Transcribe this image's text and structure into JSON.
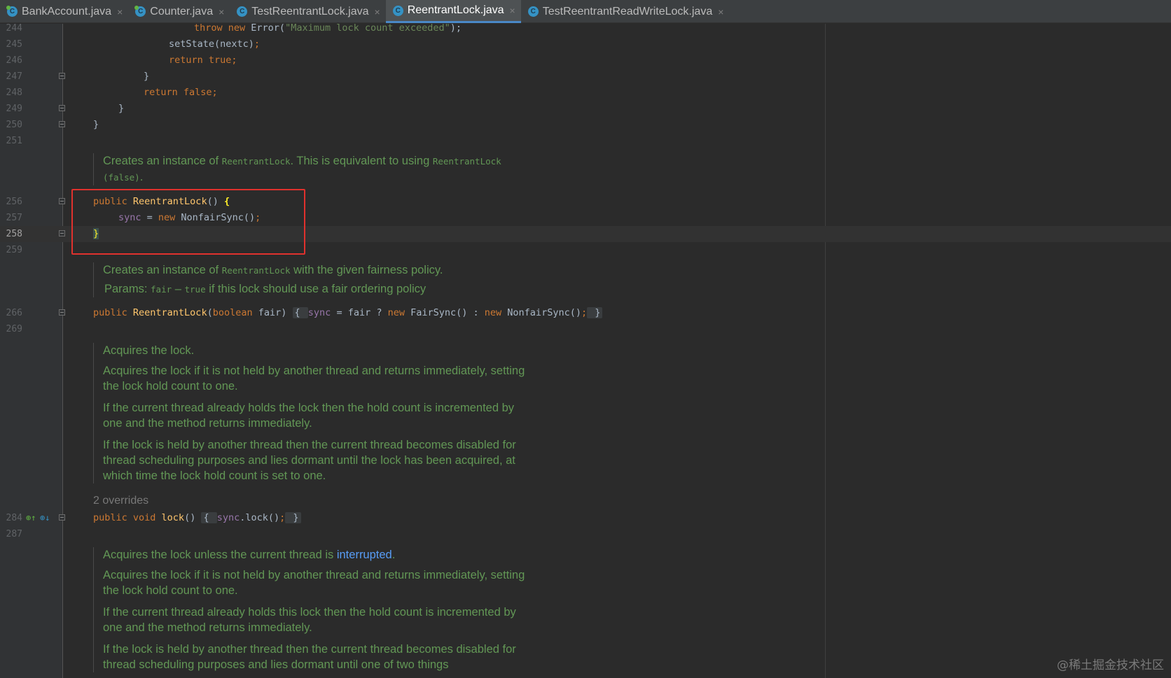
{
  "tabs": [
    {
      "label": "BankAccount.java",
      "close": "×",
      "active": false
    },
    {
      "label": "Counter.java",
      "close": "×",
      "active": false
    },
    {
      "label": "TestReentrantLock.java",
      "close": "×",
      "active": false
    },
    {
      "label": "ReentrantLock.java",
      "close": "×",
      "active": true
    },
    {
      "label": "TestReentrantReadWriteLock.java",
      "close": "×",
      "active": false
    }
  ],
  "file_icon_letter": "C",
  "lines": {
    "l244": {
      "num": "244",
      "t1": "throw new ",
      "t2": "Error(",
      "t3": "\"Maximum lock count exceeded\"",
      "t4": ");"
    },
    "l245": {
      "num": "245",
      "t1": "setState(nextc)",
      "t2": ";"
    },
    "l246": {
      "num": "246",
      "t1": "return true;"
    },
    "l247": {
      "num": "247",
      "t1": "}"
    },
    "l248": {
      "num": "248",
      "t1": "return false;"
    },
    "l249": {
      "num": "249",
      "t1": "}"
    },
    "l250": {
      "num": "250",
      "t1": "}"
    },
    "l251": {
      "num": "251"
    },
    "l256": {
      "num": "256",
      "t1": "public ",
      "t2": "ReentrantLock",
      "t3": "() ",
      "t4": "{"
    },
    "l257": {
      "num": "257",
      "t1": "sync",
      "t2": " = ",
      "t3": "new ",
      "t4": "NonfairSync()",
      "t5": ";"
    },
    "l258": {
      "num": "258",
      "t1": "}"
    },
    "l259": {
      "num": "259"
    },
    "l266": {
      "num": "266",
      "t1": "public ",
      "t2": "ReentrantLock",
      "t3": "(",
      "t4": "boolean ",
      "t5": "fair) ",
      "t6": "{ ",
      "t7": "sync",
      "t8": " = fair ? ",
      "t9": "new ",
      "t10": "FairSync() : ",
      "t11": "new ",
      "t12": "NonfairSync()",
      "t13": ";",
      "t14": " }"
    },
    "l269": {
      "num": "269"
    },
    "l284": {
      "num": "284",
      "t1": "public void ",
      "t2": "lock",
      "t3": "() ",
      "t4": "{ ",
      "t5": "sync",
      "t6": ".lock()",
      "t7": ";",
      "t8": " }"
    },
    "l287": {
      "num": "287"
    }
  },
  "docs": {
    "d1": {
      "a": "Creates an instance of ",
      "b": "ReentrantLock",
      "c": ". This is equivalent to using ",
      "d": "ReentrantLock",
      "e": "(false)",
      "f": "."
    },
    "d2": {
      "a": "Creates an instance of ",
      "b": "ReentrantLock",
      "c": " with the given fairness policy.",
      "p1": "Params: ",
      "p2": "fair",
      "p3": " – ",
      "p4": "true",
      "p5": " if this lock should use a fair ordering policy"
    },
    "d3": {
      "p1": "Acquires the lock.",
      "p2": "Acquires the lock if it is not held by another thread and returns immediately, setting the lock hold count to one.",
      "p3": "If the current thread already holds the lock then the hold count is incremented by one and the method returns immediately.",
      "p4": "If the lock is held by another thread then the current thread becomes disabled for thread scheduling purposes and lies dormant until the lock has been acquired, at which time the lock hold count is set to one."
    },
    "d4": {
      "p1a": "Acquires the lock unless the current thread is ",
      "p1b": "interrupted",
      "p1c": ".",
      "p2": "Acquires the lock if it is not held by another thread and returns immediately, setting the lock hold count to one.",
      "p3": "If the current thread already holds this lock then the hold count is incremented by one and the method returns immediately.",
      "p4": "If the lock is held by another thread then the current thread becomes disabled for thread scheduling purposes and lies dormant until one of two things"
    }
  },
  "overrides_label": "2 overrides",
  "watermark": "@稀土掘金技术社区",
  "colors": {
    "keyword": "#cc7832",
    "string": "#6a8759",
    "method": "#ffc66d",
    "field": "#9876aa",
    "doc": "#629755",
    "highlight_box": "#e0312d"
  }
}
